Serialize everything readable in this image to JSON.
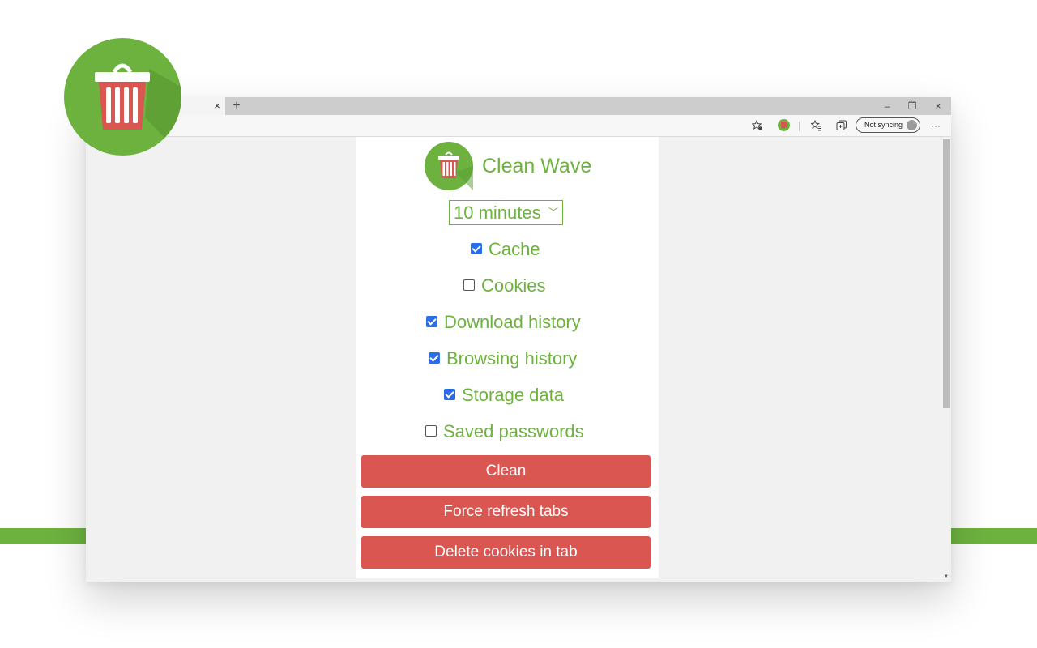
{
  "browser": {
    "tab_close": "×",
    "new_tab": "+",
    "window_controls": {
      "minimize": "–",
      "restore": "❐",
      "close": "×"
    },
    "toolbar": {
      "sync_label": "Not syncing",
      "menu": "···",
      "icons": [
        "star-settings-icon",
        "clean-wave-extension-icon",
        "favorites-icon",
        "collections-icon",
        "profile-avatar-icon",
        "more-menu-icon"
      ]
    }
  },
  "popup": {
    "title": "Clean Wave",
    "interval": {
      "selected": "10 minutes"
    },
    "options": [
      {
        "label": "Cache",
        "checked": true
      },
      {
        "label": "Cookies",
        "checked": false
      },
      {
        "label": "Download history",
        "checked": true
      },
      {
        "label": "Browsing history",
        "checked": true
      },
      {
        "label": "Storage data",
        "checked": true
      },
      {
        "label": "Saved passwords",
        "checked": false
      }
    ],
    "buttons": {
      "clean": "Clean",
      "refresh": "Force refresh tabs",
      "delete_cookies": "Delete cookies in tab"
    }
  },
  "colors": {
    "brand_green": "#6db23f",
    "button_red": "#d95651",
    "checkbox_blue": "#2a6de8",
    "page_background": "#f1f1f1"
  }
}
